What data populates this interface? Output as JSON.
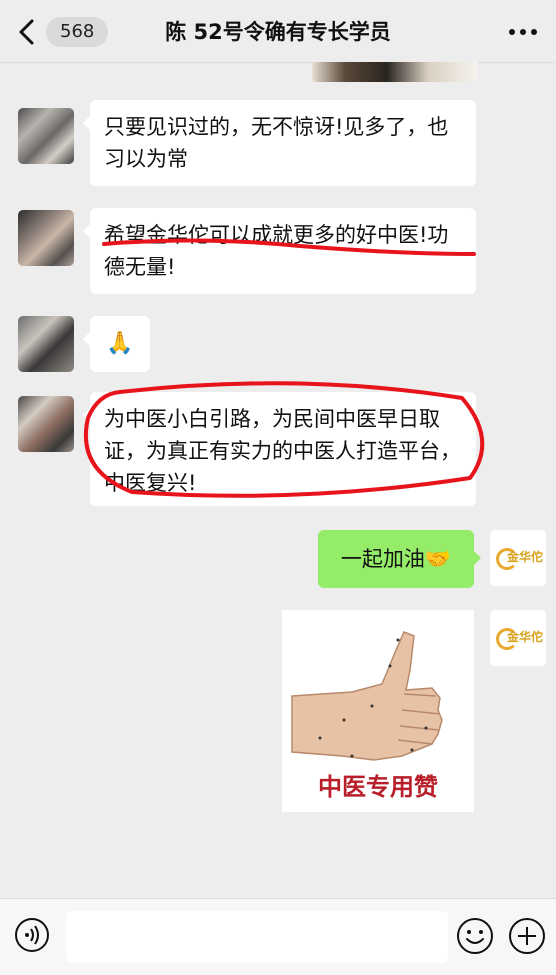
{
  "header": {
    "back_count": "568",
    "title": "陈  52号令确有专长学员",
    "more_label": "···"
  },
  "messages": [
    {
      "side": "left",
      "text": "只要见识过的，无不惊讶!见多了，也习以为常"
    },
    {
      "side": "left",
      "text": "希望金华佗可以成就更多的好中医!功德无量!"
    },
    {
      "side": "left",
      "text": "🙏"
    },
    {
      "side": "left",
      "text": "为中医小白引路，为民间中医早日取证，为真正有实力的中医人打造平台，中医复兴!"
    },
    {
      "side": "right",
      "text": "一起加油🤝"
    }
  ],
  "my_avatar": {
    "logo_text": "金华佗"
  },
  "image_message": {
    "caption": "中医专用赞"
  },
  "annotation_color": "#e8141c",
  "input_bar": {
    "voice_icon": "voice-icon",
    "emoji_icon": "emoji-icon",
    "plus_icon": "plus-icon"
  }
}
